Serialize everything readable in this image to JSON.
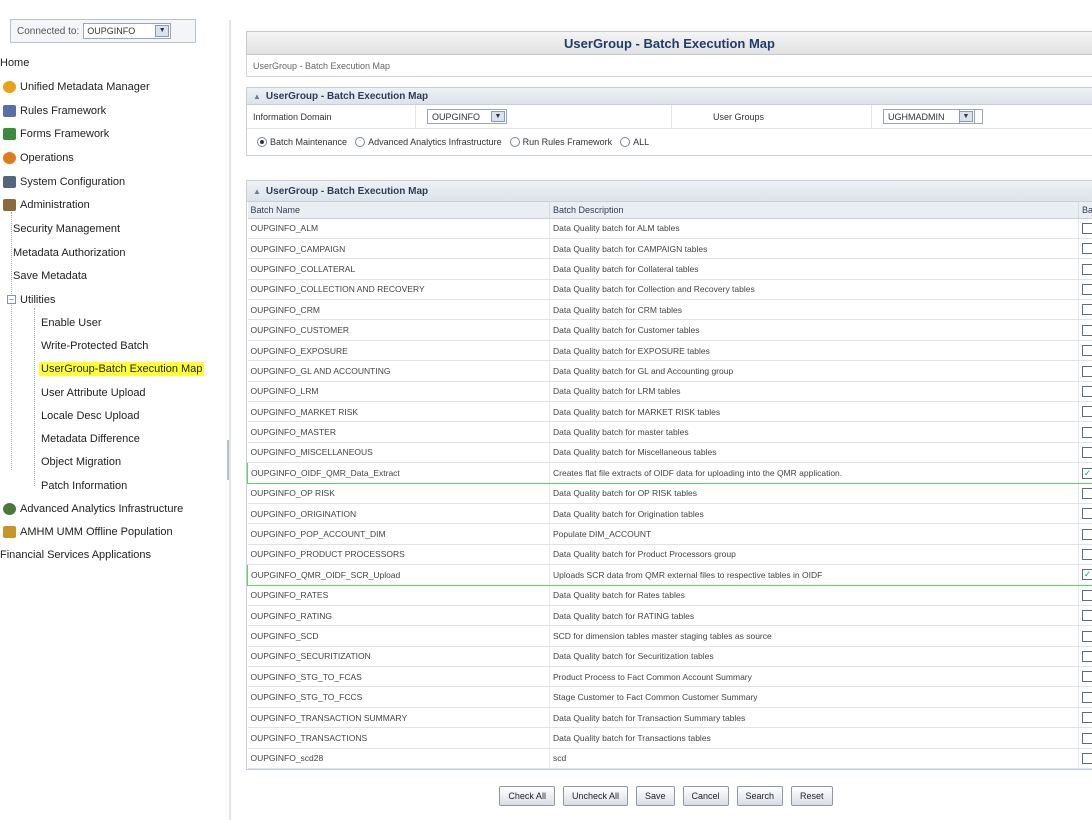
{
  "sidebar": {
    "connected_label": "Connected to:",
    "connected_value": "OUPGINFO",
    "items": [
      {
        "label": "Home"
      },
      {
        "label": "Unified Metadata Manager",
        "icon": "globe-icon",
        "color": "#e8a21a"
      },
      {
        "label": "Rules Framework",
        "icon": "rules-icon",
        "color": "#5a6fa3"
      },
      {
        "label": "Forms Framework",
        "icon": "forms-icon",
        "color": "#3c8a3c"
      },
      {
        "label": "Operations",
        "icon": "operations-icon",
        "color": "#e07a1a"
      },
      {
        "label": "System Configuration",
        "icon": "system-config-icon",
        "color": "#556677"
      },
      {
        "label": "Administration",
        "icon": "administration-icon",
        "color": "#8a6b3a"
      },
      {
        "label": "Security Management"
      },
      {
        "label": "Metadata Authorization"
      },
      {
        "label": "Save Metadata"
      },
      {
        "label": "Utilities"
      },
      {
        "label": "Enable User"
      },
      {
        "label": "Write-Protected Batch"
      },
      {
        "label": "UserGroup-Batch Execution Map"
      },
      {
        "label": "User Attribute Upload"
      },
      {
        "label": "Locale Desc Upload"
      },
      {
        "label": "Metadata Difference"
      },
      {
        "label": "Object Migration"
      },
      {
        "label": "Patch Information"
      },
      {
        "label": "Advanced Analytics Infrastructure",
        "icon": "analytics-icon",
        "color": "#4a7a3a"
      },
      {
        "label": "AMHM UMM Offline Population",
        "icon": "offline-population-icon",
        "color": "#c7962a"
      },
      {
        "label": "Financial Services Applications"
      }
    ]
  },
  "page": {
    "title": "UserGroup - Batch Execution Map",
    "breadcrumb": "UserGroup - Batch Execution Map"
  },
  "filter": {
    "section_title": "UserGroup - Batch Execution Map",
    "info_domain_label": "Information Domain",
    "info_domain_value": "OUPGINFO",
    "user_groups_label": "User Groups",
    "user_groups_value": "UGHMADMIN",
    "radios": [
      {
        "label": "Batch Maintenance",
        "selected": true
      },
      {
        "label": "Advanced Analytics Infrastructure",
        "selected": false
      },
      {
        "label": "Run Rules Framework",
        "selected": false
      },
      {
        "label": "ALL",
        "selected": false
      }
    ]
  },
  "grid": {
    "section_title": "UserGroup - Batch Execution Map",
    "columns": [
      "Batch Name",
      "Batch Description",
      "Bat"
    ],
    "rows": [
      {
        "name": "OUPGINFO_ALM",
        "desc": "Data Quality batch for ALM tables",
        "checked": false
      },
      {
        "name": "OUPGINFO_CAMPAIGN",
        "desc": "Data Quality batch for CAMPAIGN tables",
        "checked": false
      },
      {
        "name": "OUPGINFO_COLLATERAL",
        "desc": "Data Quality batch for Collateral tables",
        "checked": false
      },
      {
        "name": "OUPGINFO_COLLECTION AND RECOVERY",
        "desc": "Data Quality batch for Collection and Recovery tables",
        "checked": false
      },
      {
        "name": "OUPGINFO_CRM",
        "desc": "Data Quality batch for CRM tables",
        "checked": false
      },
      {
        "name": "OUPGINFO_CUSTOMER",
        "desc": "Data Quality batch for Customer tables",
        "checked": false
      },
      {
        "name": "OUPGINFO_EXPOSURE",
        "desc": "Data Quality batch for EXPOSURE tables",
        "checked": false
      },
      {
        "name": "OUPGINFO_GL AND ACCOUNTING",
        "desc": "Data Quality batch for GL and Accounting group",
        "checked": false
      },
      {
        "name": "OUPGINFO_LRM",
        "desc": "Data Quality batch for LRM tables",
        "checked": false
      },
      {
        "name": "OUPGINFO_MARKET RISK",
        "desc": "Data Quality batch for MARKET RISK tables",
        "checked": false
      },
      {
        "name": "OUPGINFO_MASTER",
        "desc": "Data Quality batch for master tables",
        "checked": false
      },
      {
        "name": "OUPGINFO_MISCELLANEOUS",
        "desc": "Data Quality batch for Miscellaneous tables",
        "checked": false
      },
      {
        "name": "OUPGINFO_OIDF_QMR_Data_Extract",
        "desc": "Creates flat file extracts of OIDF data for uploading into the QMR application.",
        "checked": true
      },
      {
        "name": "OUPGINFO_OP RISK",
        "desc": "Data Quality batch for OP RISK tables",
        "checked": false
      },
      {
        "name": "OUPGINFO_ORIGINATION",
        "desc": "Data Quality batch for Origination tables",
        "checked": false
      },
      {
        "name": "OUPGINFO_POP_ACCOUNT_DIM",
        "desc": "Populate DIM_ACCOUNT",
        "checked": false
      },
      {
        "name": "OUPGINFO_PRODUCT PROCESSORS",
        "desc": "Data Quality batch for Product Processors group",
        "checked": false
      },
      {
        "name": "OUPGINFO_QMR_OIDF_SCR_Upload",
        "desc": "Uploads SCR data from QMR external files to respective tables in OIDF",
        "checked": true
      },
      {
        "name": "OUPGINFO_RATES",
        "desc": "Data Quality batch for Rates tables",
        "checked": false
      },
      {
        "name": "OUPGINFO_RATING",
        "desc": "Data Quality batch for RATING tables",
        "checked": false
      },
      {
        "name": "OUPGINFO_SCD",
        "desc": "SCD for dimension tables master staging tables as source",
        "checked": false
      },
      {
        "name": "OUPGINFO_SECURITIZATION",
        "desc": "Data Quality batch for Securitization tables",
        "checked": false
      },
      {
        "name": "OUPGINFO_STG_TO_FCAS",
        "desc": "Product Process to Fact Common Account Summary",
        "checked": false
      },
      {
        "name": "OUPGINFO_STG_TO_FCCS",
        "desc": "Stage Customer to Fact Common Customer Summary",
        "checked": false
      },
      {
        "name": "OUPGINFO_TRANSACTION SUMMARY",
        "desc": "Data Quality batch for Transaction Summary tables",
        "checked": false
      },
      {
        "name": "OUPGINFO_TRANSACTIONS",
        "desc": "Data Quality batch for Transactions tables",
        "checked": false
      },
      {
        "name": "OUPGINFO_scd28",
        "desc": "scd",
        "checked": false
      }
    ]
  },
  "buttons": {
    "check_all": "Check All",
    "uncheck_all": "Uncheck All",
    "save": "Save",
    "cancel": "Cancel",
    "search": "Search",
    "reset": "Reset"
  }
}
